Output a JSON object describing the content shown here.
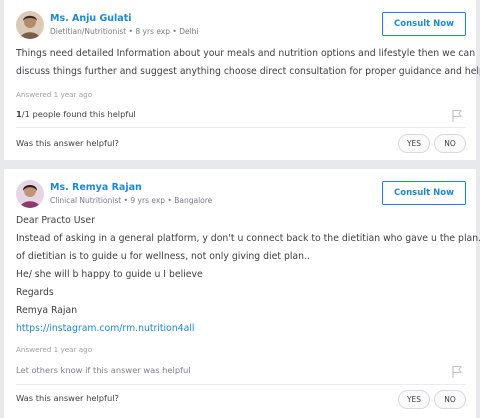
{
  "answers": [
    {
      "doctor_name": "Ms. Anju Gulati",
      "doctor_meta": "Dietitian/Nutritionist • 8 yrs exp • Delhi",
      "consult_label": "Consult Now",
      "text_lines": [
        "Things need detailed Information about your meals and nutrition options and lifestyle then we can",
        "discuss things further and suggest anything choose direct consultation for proper guidance and help."
      ],
      "answered": "Answered 1 year ago",
      "helpful_bold": "1",
      "helpful_rest": "/1 people found this helpful",
      "question": "Was this answer helpful?",
      "yes_label": "YES",
      "no_label": "NO"
    },
    {
      "doctor_name": "Ms. Remya Rajan",
      "doctor_meta": "Clinical Nutritionist • 9 yrs exp • Bangalore",
      "consult_label": "Consult Now",
      "text_lines": [
        "Dear Practo User",
        "Instead of asking in a general platform, y don't u connect back to the dietitian who gave u the plan.Role",
        "of dietitian is to guide u for wellness, not only giving diet plan..",
        "He/ she will b happy to guide u I believe",
        "Regards",
        "Remya Rajan"
      ],
      "link": "https://instagram.com/rm.nutrition4all",
      "answered": "Answered 1 year ago",
      "helpful_text": "Let others know if this answer was helpful",
      "question": "Was this answer helpful?",
      "yes_label": "YES",
      "no_label": "NO"
    }
  ],
  "colors": {
    "accent": "#1c8ad2",
    "background": "#e8e9ec"
  },
  "icons": {
    "flag": "flag-icon"
  }
}
